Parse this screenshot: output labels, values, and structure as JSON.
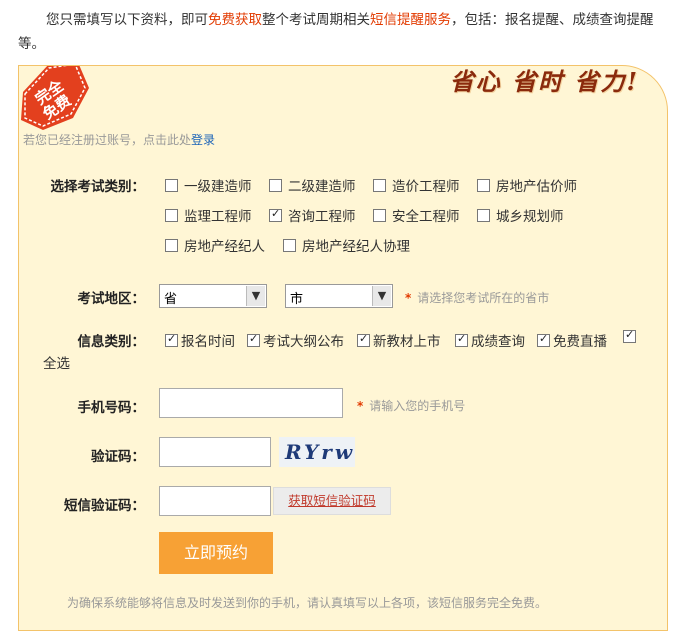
{
  "intro": {
    "part1": "您只需填写以下资料，即可",
    "highlight1": "免费获取",
    "part2": "整个考试周期相关",
    "highlight2": "短信提醒服务",
    "part3": "，包括：报名提醒、成绩查询提醒等。"
  },
  "badge": {
    "line1": "完全",
    "line2": "免费"
  },
  "slogan": "省心 省时 省力!",
  "login_hint": {
    "text": "若您已经注册过账号，点击此处",
    "link": "登录"
  },
  "exam_category": {
    "label": "选择考试类别：",
    "options": [
      {
        "label": "一级建造师",
        "checked": false
      },
      {
        "label": "二级建造师",
        "checked": false
      },
      {
        "label": "造价工程师",
        "checked": false
      },
      {
        "label": "房地产估价师",
        "checked": false
      },
      {
        "label": "监理工程师",
        "checked": false
      },
      {
        "label": "咨询工程师",
        "checked": true
      },
      {
        "label": "安全工程师",
        "checked": false
      },
      {
        "label": "城乡规划师",
        "checked": false
      },
      {
        "label": "房地产经纪人",
        "checked": false
      },
      {
        "label": "房地产经纪人协理",
        "checked": false
      }
    ]
  },
  "region": {
    "label": "考试地区：",
    "province": "省",
    "city": "市",
    "hint": "请选择您考试所在的省市",
    "star": "*"
  },
  "info_types": {
    "label": "信息类别：",
    "options": [
      {
        "label": "报名时间",
        "checked": true
      },
      {
        "label": "考试大纲公布",
        "checked": true
      },
      {
        "label": "新教材上市",
        "checked": true
      },
      {
        "label": "成绩查询",
        "checked": true
      },
      {
        "label": "免费直播",
        "checked": true
      }
    ],
    "select_all": {
      "label": "全选",
      "checked": true
    }
  },
  "phone": {
    "label": "手机号码：",
    "value": "",
    "hint": "请输入您的手机号",
    "star": "*"
  },
  "captcha": {
    "label": "验证码：",
    "value": "",
    "image_text": "RYrw"
  },
  "sms": {
    "label": "短信验证码：",
    "value": "",
    "button": "获取短信验证码"
  },
  "submit": {
    "label": "立即预约"
  },
  "footnote": "为确保系统能够将信息及时发送到你的手机，请认真填写以上各项，该短信服务完全免费。"
}
